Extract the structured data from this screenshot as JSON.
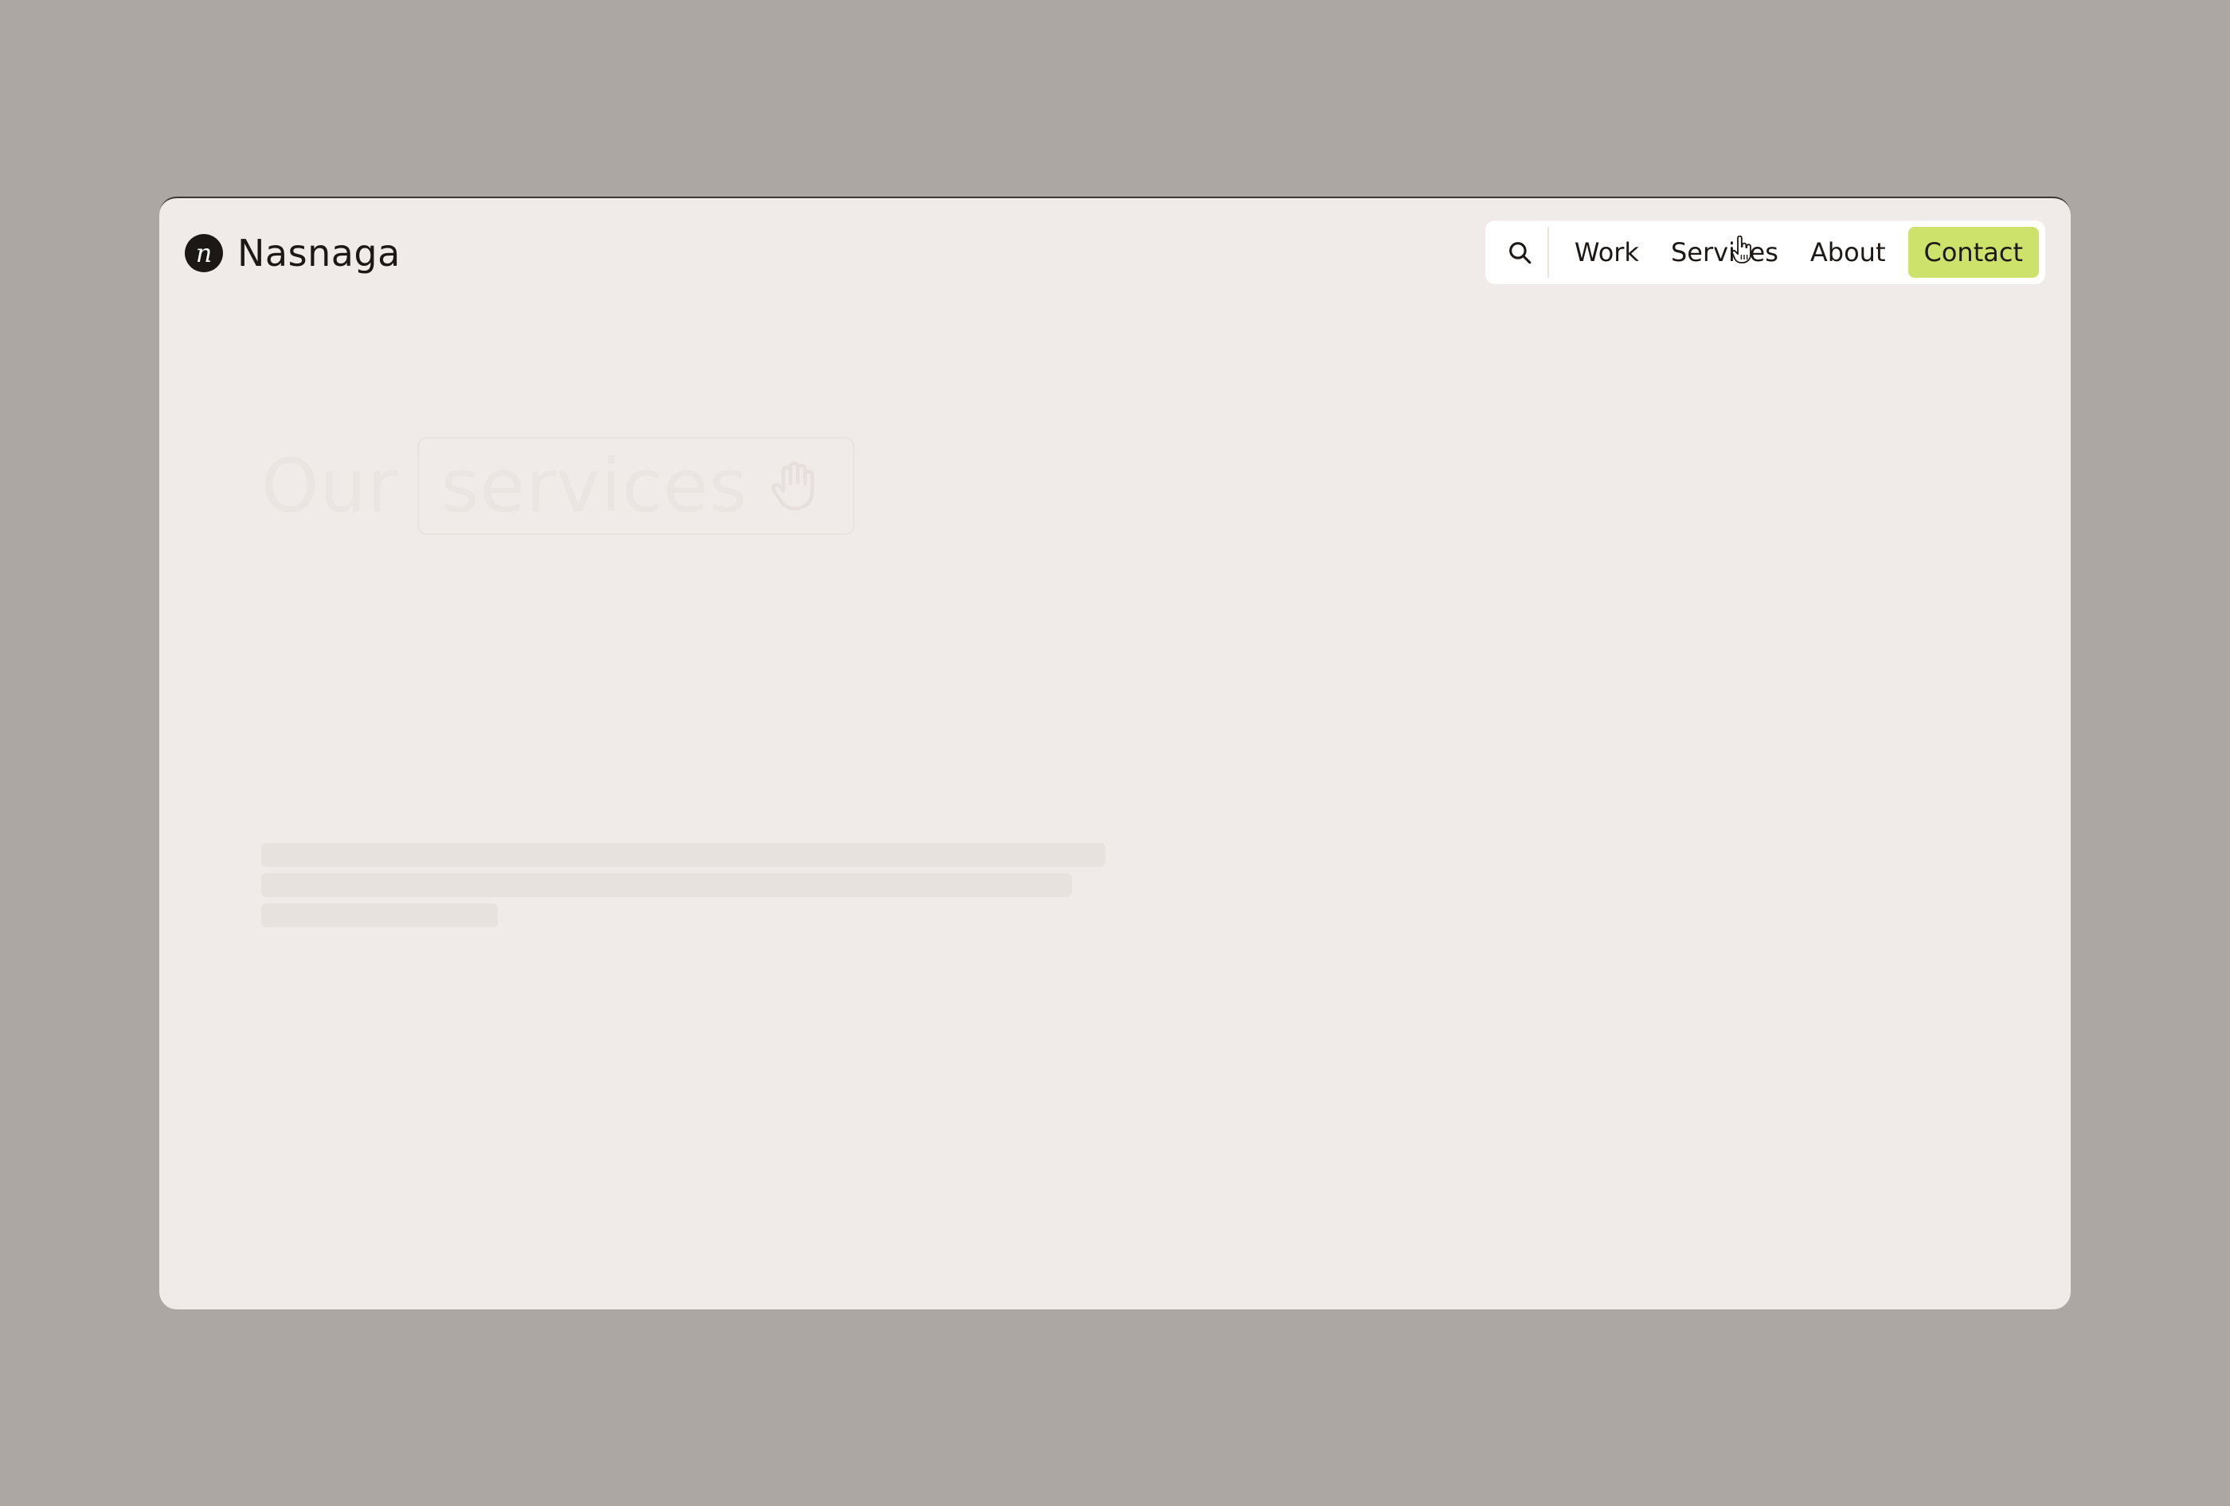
{
  "brand": {
    "logo_letter": "n",
    "name": "Nasnaga"
  },
  "nav": {
    "items": [
      {
        "label": "Work"
      },
      {
        "label": "Services"
      },
      {
        "label": "About"
      }
    ],
    "contact_label": "Contact",
    "search_icon": "search-icon"
  },
  "hero": {
    "title_prefix": "Our",
    "title_highlight": "services"
  },
  "colors": {
    "backdrop": "#aca7a3",
    "page": "#f0ebe8",
    "accent": "#cde26a",
    "ink": "#1c1816"
  }
}
